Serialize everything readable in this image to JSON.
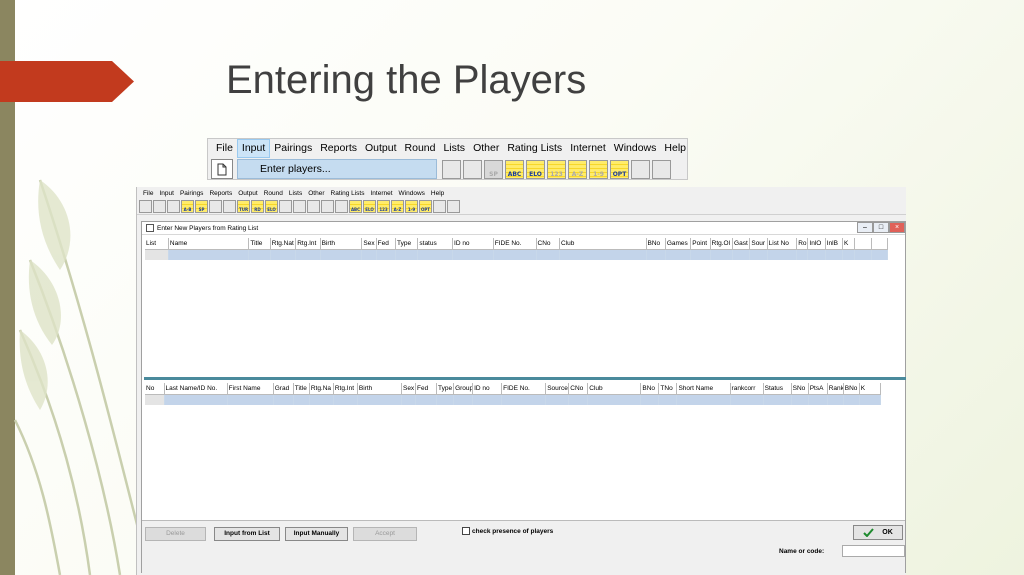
{
  "slide": {
    "title": "Entering the Players"
  },
  "snippet": {
    "menu": [
      "File",
      "Input",
      "Pairings",
      "Reports",
      "Output",
      "Round",
      "Lists",
      "Other",
      "Rating Lists",
      "Internet",
      "Windows",
      "Help"
    ],
    "active_menu": "Input",
    "dropdown_item": "Enter players...",
    "tools": [
      "",
      "",
      "SP",
      "ABC",
      "ELO",
      "123",
      "A-Z",
      "1-9",
      "OPT",
      "",
      ""
    ]
  },
  "app": {
    "menu": [
      "File",
      "Input",
      "Pairings",
      "Reports",
      "Output",
      "Round",
      "Lists",
      "Other",
      "Rating Lists",
      "Internet",
      "Windows",
      "Help"
    ],
    "tools": [
      "",
      "",
      "",
      "A-B",
      "SP",
      "",
      "",
      "TUR",
      "RD",
      "ELO",
      "",
      "",
      "",
      "",
      "",
      "ABC",
      "ELO",
      "123",
      "A-Z",
      "1-9",
      "OPT",
      "",
      ""
    ],
    "window_title": "Enter New Players from Rating List",
    "grid1_headers": [
      "List",
      "Name",
      "Title",
      "Rtg.Nat",
      "Rtg.Int",
      "Birth",
      "Sex",
      "Fed",
      "Type",
      "status",
      "ID no",
      "FIDE No.",
      "CNo",
      "Club",
      "BNo",
      "Games",
      "Point",
      "Rtg.Ol",
      "Gast",
      "Sour",
      "List No",
      "Ro",
      "InlO",
      "InlB",
      "K",
      "",
      ""
    ],
    "grid2_headers": [
      "No",
      "Last Name/ID No.",
      "First Name",
      "Grad",
      "Title",
      "Rtg.Na",
      "Rtg.Int",
      "Birth",
      "Sex",
      "Fed",
      "Type",
      "Group",
      "ID no",
      "FIDE No.",
      "Source",
      "CNo",
      "Club",
      "BNo",
      "TNo",
      "Short Name",
      "rankcorr",
      "Status",
      "SNo",
      "PtsA",
      "Rank",
      "BNo",
      "K"
    ],
    "buttons": {
      "delete": "Delete",
      "input_from_list": "Input from List",
      "input_manually": "Input Manually",
      "accept": "Accept",
      "ok": "OK"
    },
    "check_presence": "check presence of players",
    "name_or_code": "Name or code:"
  },
  "colors": {
    "accent_red": "#c23a1e",
    "side_bar": "#8b8660",
    "row_highlight": "#c3d4ea",
    "splitter": "#4a8a9c"
  }
}
